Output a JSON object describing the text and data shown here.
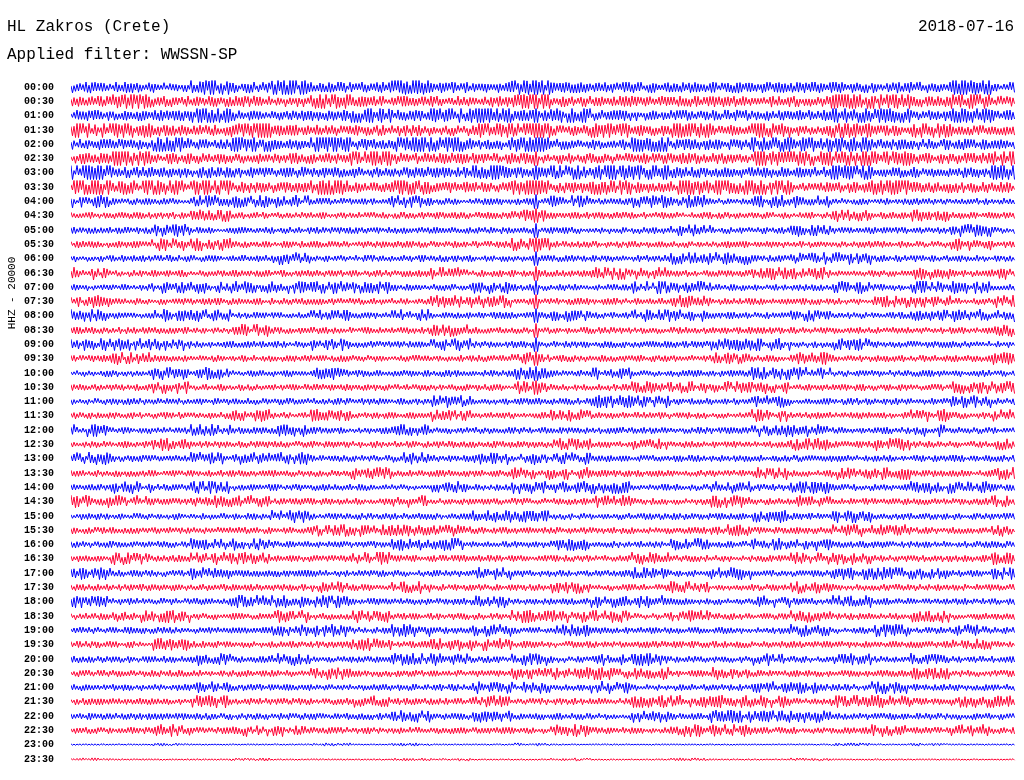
{
  "header": {
    "station": "HL Zakros (Crete)",
    "date": "2018-07-16",
    "filter": "Applied filter: WWSSN-SP"
  },
  "channel_label": "HHZ - 20000",
  "rows": [
    {
      "time": "00:00",
      "color": "#0000ff"
    },
    {
      "time": "00:30",
      "color": "#ff0033"
    },
    {
      "time": "01:00",
      "color": "#0000ff"
    },
    {
      "time": "01:30",
      "color": "#ff0033"
    },
    {
      "time": "02:00",
      "color": "#0000ff"
    },
    {
      "time": "02:30",
      "color": "#ff0033"
    },
    {
      "time": "03:00",
      "color": "#0000ff"
    },
    {
      "time": "03:30",
      "color": "#ff0033"
    },
    {
      "time": "04:00",
      "color": "#0000ff"
    },
    {
      "time": "04:30",
      "color": "#ff0033"
    },
    {
      "time": "05:00",
      "color": "#0000ff"
    },
    {
      "time": "05:30",
      "color": "#ff0033"
    },
    {
      "time": "06:00",
      "color": "#0000ff"
    },
    {
      "time": "06:30",
      "color": "#ff0033"
    },
    {
      "time": "07:00",
      "color": "#0000ff"
    },
    {
      "time": "07:30",
      "color": "#ff0033"
    },
    {
      "time": "08:00",
      "color": "#0000ff"
    },
    {
      "time": "08:30",
      "color": "#ff0033"
    },
    {
      "time": "09:00",
      "color": "#0000ff"
    },
    {
      "time": "09:30",
      "color": "#ff0033"
    },
    {
      "time": "10:00",
      "color": "#0000ff"
    },
    {
      "time": "10:30",
      "color": "#ff0033"
    },
    {
      "time": "11:00",
      "color": "#0000ff"
    },
    {
      "time": "11:30",
      "color": "#ff0033"
    },
    {
      "time": "12:00",
      "color": "#0000ff"
    },
    {
      "time": "12:30",
      "color": "#ff0033"
    },
    {
      "time": "13:00",
      "color": "#0000ff"
    },
    {
      "time": "13:30",
      "color": "#ff0033"
    },
    {
      "time": "14:00",
      "color": "#0000ff"
    },
    {
      "time": "14:30",
      "color": "#ff0033"
    },
    {
      "time": "15:00",
      "color": "#0000ff"
    },
    {
      "time": "15:30",
      "color": "#ff0033"
    },
    {
      "time": "16:00",
      "color": "#0000ff"
    },
    {
      "time": "16:30",
      "color": "#ff0033"
    },
    {
      "time": "17:00",
      "color": "#0000ff"
    },
    {
      "time": "17:30",
      "color": "#ff0033"
    },
    {
      "time": "18:00",
      "color": "#0000ff"
    },
    {
      "time": "18:30",
      "color": "#ff0033"
    },
    {
      "time": "19:00",
      "color": "#0000ff"
    },
    {
      "time": "19:30",
      "color": "#ff0033"
    },
    {
      "time": "20:00",
      "color": "#0000ff"
    },
    {
      "time": "20:30",
      "color": "#ff0033"
    },
    {
      "time": "21:00",
      "color": "#0000ff"
    },
    {
      "time": "21:30",
      "color": "#ff0033"
    },
    {
      "time": "22:00",
      "color": "#0000ff"
    },
    {
      "time": "22:30",
      "color": "#ff0033"
    },
    {
      "time": "23:00",
      "color": "#0000ff"
    },
    {
      "time": "23:30",
      "color": "#ff0033"
    }
  ]
}
